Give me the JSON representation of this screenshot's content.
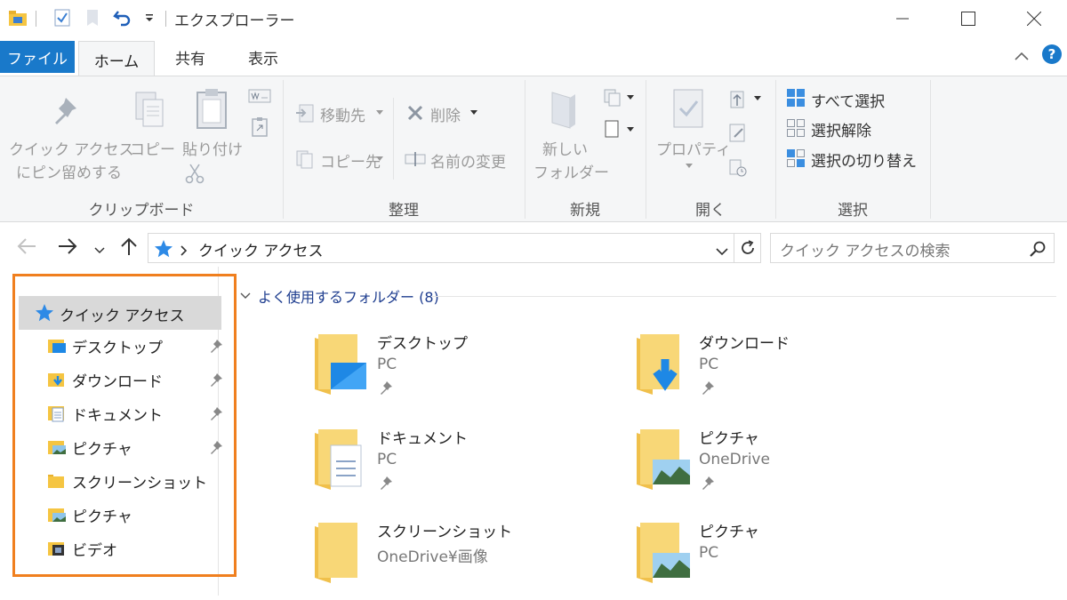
{
  "window": {
    "title": "エクスプローラー",
    "accent": "#1979ca",
    "highlight_border": "#f07f1e"
  },
  "tabs": {
    "file": "ファイル",
    "home": "ホーム",
    "share": "共有",
    "view": "表示"
  },
  "ribbon": {
    "clipboard": {
      "pin_line1": "クイック アクセス",
      "pin_line2": "にピン留めする",
      "copy": "コピー",
      "paste": "貼り付け",
      "label": "クリップボード"
    },
    "organize": {
      "move_to": "移動先",
      "copy_to": "コピー先",
      "delete": "削除",
      "rename": "名前の変更",
      "label": "整理"
    },
    "new": {
      "new_folder_line1": "新しい",
      "new_folder_line2": "フォルダー",
      "label": "新規"
    },
    "open": {
      "properties": "プロパティ",
      "label": "開く"
    },
    "select": {
      "select_all": "すべて選択",
      "select_none": "選択解除",
      "invert": "選択の切り替え",
      "label": "選択"
    }
  },
  "address": {
    "path": "クイック アクセス",
    "search_placeholder": "クイック アクセスの検索"
  },
  "navpane": {
    "quick_access": "クイック アクセス",
    "items": [
      {
        "label": "デスクトップ",
        "icon": "desktop-folder-icon",
        "pinned": true
      },
      {
        "label": "ダウンロード",
        "icon": "downloads-folder-icon",
        "pinned": true
      },
      {
        "label": "ドキュメント",
        "icon": "documents-folder-icon",
        "pinned": true
      },
      {
        "label": "ピクチャ",
        "icon": "pictures-folder-icon",
        "pinned": true
      },
      {
        "label": "スクリーンショット",
        "icon": "folder-icon",
        "pinned": false
      },
      {
        "label": "ピクチャ",
        "icon": "pictures-folder-icon",
        "pinned": false
      },
      {
        "label": "ビデオ",
        "icon": "videos-folder-icon",
        "pinned": false
      }
    ]
  },
  "main": {
    "section_title": "よく使用するフォルダー (8)",
    "folders": [
      {
        "name": "デスクトップ",
        "location": "PC",
        "pinned": true
      },
      {
        "name": "ダウンロード",
        "location": "PC",
        "pinned": true
      },
      {
        "name": "ドキュメント",
        "location": "PC",
        "pinned": true
      },
      {
        "name": "ピクチャ",
        "location": "OneDrive",
        "pinned": true
      },
      {
        "name": "スクリーンショット",
        "location": "OneDrive¥画像",
        "pinned": false
      },
      {
        "name": "ピクチャ",
        "location": "PC",
        "pinned": false
      }
    ]
  }
}
